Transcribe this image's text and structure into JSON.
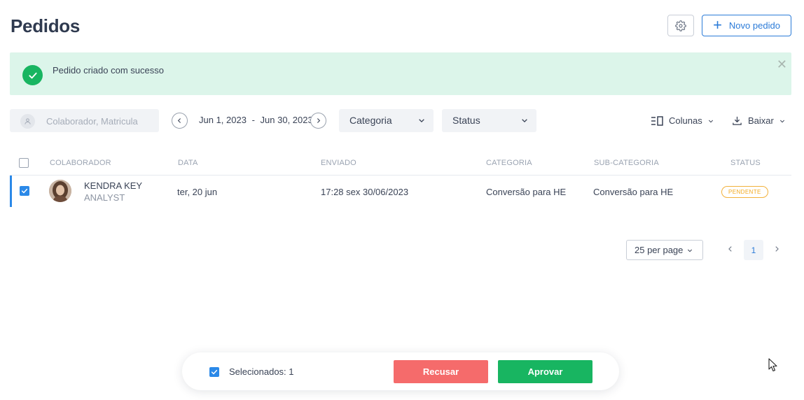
{
  "page": {
    "title": "Pedidos"
  },
  "header": {
    "settings_icon": "gear-icon",
    "new_button_label": "Novo pedido",
    "new_button_icon": "plus-icon"
  },
  "alert": {
    "message": "Pedido criado com sucesso",
    "icon": "check-circle-icon",
    "close_icon": "close-icon",
    "color": "#dcf5ea",
    "icon_color": "#18b561"
  },
  "filters": {
    "search_placeholder": "Colaborador, Matricula",
    "date_start": "Jun 1, 2023",
    "date_separator": "-",
    "date_end": "Jun 30, 2023",
    "category_label": "Categoria",
    "status_label": "Status",
    "columns_label": "Colunas",
    "download_label": "Baixar"
  },
  "table": {
    "columns": [
      "COLABORADOR",
      "DATA",
      "ENVIADO",
      "CATEGORIA",
      "SUB-CATEGORIA",
      "STATUS"
    ],
    "rows": [
      {
        "checked": true,
        "name": "KENDRA KEY",
        "role": "ANALYST",
        "date": "ter, 20 jun",
        "sent": "17:28 sex 30/06/2023",
        "category": "Conversão para HE",
        "subcategory": "Conversão para HE",
        "status": "PENDENTE",
        "status_color": "#f2a91f"
      }
    ]
  },
  "pagination": {
    "per_page_label": "25 per page",
    "current_page": "1"
  },
  "bulk": {
    "selected_label": "Selecionados: 1",
    "reject_label": "Recusar",
    "approve_label": "Aprovar",
    "reject_color": "#f56b6b",
    "approve_color": "#18b561"
  },
  "colors": {
    "accent": "#2b7bd8"
  }
}
